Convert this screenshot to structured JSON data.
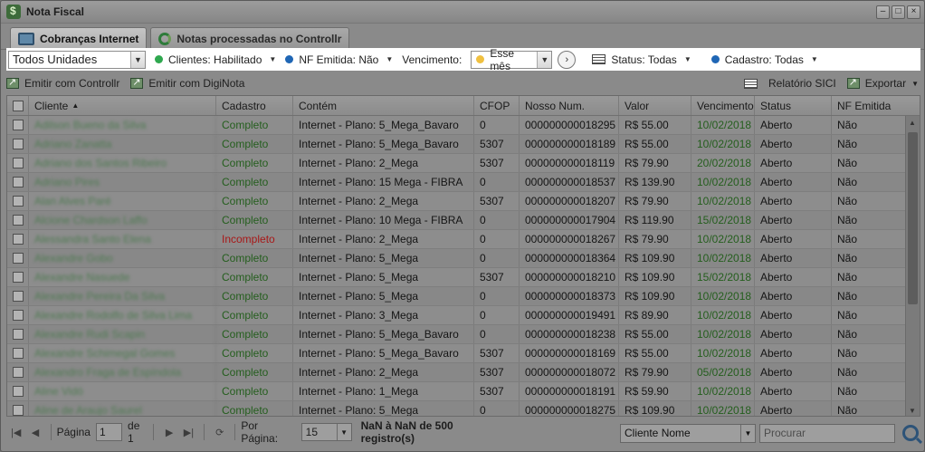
{
  "window": {
    "title": "Nota Fiscal"
  },
  "tabs": [
    {
      "label": "Cobranças Internet"
    },
    {
      "label": "Notas processadas no Controllr"
    }
  ],
  "filters": {
    "unit": "Todos Unidades",
    "clientes": "Clientes: Habilitado",
    "nf_emitida": "NF Emitida: Não",
    "vencimento_label": "Vencimento:",
    "vencimento_value": "Esse mês",
    "status": "Status: Todas",
    "cadastro": "Cadastro: Todas",
    "colors": {
      "clientes": "#2fa84f",
      "nf": "#1f66b5",
      "vencimento": "#f0c040",
      "cadastro": "#1f66b5"
    }
  },
  "toolbar": {
    "emit_controllr": "Emitir com Controllr",
    "emit_diginota": "Emitir com DigiNota",
    "relatorio": "Relatório SICI",
    "exportar": "Exportar"
  },
  "grid": {
    "columns": [
      "Cliente",
      "Cadastro",
      "Contém",
      "CFOP",
      "Nosso Num.",
      "Valor",
      "Vencimento",
      "Status",
      "NF Emitida"
    ],
    "rows": [
      {
        "cliente": "Adilson Bueno da Silva",
        "cadastro": "Completo",
        "contem": "Internet - Plano: 5_Mega_Bavaro",
        "cfop": "0",
        "nosso": "000000000018295",
        "valor": "R$ 55.00",
        "venc": "10/02/2018",
        "status": "Aberto",
        "nf": "Não"
      },
      {
        "cliente": "Adriano Zanatta",
        "cadastro": "Completo",
        "contem": "Internet - Plano: 5_Mega_Bavaro",
        "cfop": "5307",
        "nosso": "000000000018189",
        "valor": "R$ 55.00",
        "venc": "10/02/2018",
        "status": "Aberto",
        "nf": "Não"
      },
      {
        "cliente": "Adriano dos Santos Ribeiro",
        "cadastro": "Completo",
        "contem": "Internet - Plano: 2_Mega",
        "cfop": "5307",
        "nosso": "000000000018119",
        "valor": "R$ 79.90",
        "venc": "20/02/2018",
        "status": "Aberto",
        "nf": "Não"
      },
      {
        "cliente": "Adriano Pires",
        "cadastro": "Completo",
        "contem": "Internet - Plano: 15 Mega - FIBRA",
        "cfop": "0",
        "nosso": "000000000018537",
        "valor": "R$ 139.90",
        "venc": "10/02/2018",
        "status": "Aberto",
        "nf": "Não"
      },
      {
        "cliente": "Alan Alves Paré",
        "cadastro": "Completo",
        "contem": "Internet - Plano: 2_Mega",
        "cfop": "5307",
        "nosso": "000000000018207",
        "valor": "R$ 79.90",
        "venc": "10/02/2018",
        "status": "Aberto",
        "nf": "Não"
      },
      {
        "cliente": "Alcione Chardson Laffo",
        "cadastro": "Completo",
        "contem": "Internet - Plano: 10 Mega - FIBRA",
        "cfop": "0",
        "nosso": "000000000017904",
        "valor": "R$ 119.90",
        "venc": "15/02/2018",
        "status": "Aberto",
        "nf": "Não"
      },
      {
        "cliente": "Alessandra Santo Elena",
        "cadastro": "Incompleto",
        "contem": "Internet - Plano: 2_Mega",
        "cfop": "0",
        "nosso": "000000000018267",
        "valor": "R$ 79.90",
        "venc": "10/02/2018",
        "status": "Aberto",
        "nf": "Não"
      },
      {
        "cliente": "Alexandre Gobo",
        "cadastro": "Completo",
        "contem": "Internet - Plano: 5_Mega",
        "cfop": "0",
        "nosso": "000000000018364",
        "valor": "R$ 109.90",
        "venc": "10/02/2018",
        "status": "Aberto",
        "nf": "Não"
      },
      {
        "cliente": "Alexandre Nasuede",
        "cadastro": "Completo",
        "contem": "Internet - Plano: 5_Mega",
        "cfop": "5307",
        "nosso": "000000000018210",
        "valor": "R$ 109.90",
        "venc": "15/02/2018",
        "status": "Aberto",
        "nf": "Não"
      },
      {
        "cliente": "Alexandre Pereira Da Silva",
        "cadastro": "Completo",
        "contem": "Internet - Plano: 5_Mega",
        "cfop": "0",
        "nosso": "000000000018373",
        "valor": "R$ 109.90",
        "venc": "10/02/2018",
        "status": "Aberto",
        "nf": "Não"
      },
      {
        "cliente": "Alexandre Rodolfo de Silva Lima",
        "cadastro": "Completo",
        "contem": "Internet - Plano: 3_Mega",
        "cfop": "0",
        "nosso": "000000000019491",
        "valor": "R$ 89.90",
        "venc": "10/02/2018",
        "status": "Aberto",
        "nf": "Não"
      },
      {
        "cliente": "Alexandre Rudi Scapin",
        "cadastro": "Completo",
        "contem": "Internet - Plano: 5_Mega_Bavaro",
        "cfop": "0",
        "nosso": "000000000018238",
        "valor": "R$ 55.00",
        "venc": "10/02/2018",
        "status": "Aberto",
        "nf": "Não"
      },
      {
        "cliente": "Alexandre Schimegal Gomes",
        "cadastro": "Completo",
        "contem": "Internet - Plano: 5_Mega_Bavaro",
        "cfop": "5307",
        "nosso": "000000000018169",
        "valor": "R$ 55.00",
        "venc": "10/02/2018",
        "status": "Aberto",
        "nf": "Não"
      },
      {
        "cliente": "Alexandro Fraga de Espíndola",
        "cadastro": "Completo",
        "contem": "Internet - Plano: 2_Mega",
        "cfop": "5307",
        "nosso": "000000000018072",
        "valor": "R$ 79.90",
        "venc": "05/02/2018",
        "status": "Aberto",
        "nf": "Não"
      },
      {
        "cliente": "Aline Vidó",
        "cadastro": "Completo",
        "contem": "Internet - Plano: 1_Mega",
        "cfop": "5307",
        "nosso": "000000000018191",
        "valor": "R$ 59.90",
        "venc": "10/02/2018",
        "status": "Aberto",
        "nf": "Não"
      },
      {
        "cliente": "Aline de Araujo Saurel",
        "cadastro": "Completo",
        "contem": "Internet - Plano: 5_Mega",
        "cfop": "0",
        "nosso": "000000000018275",
        "valor": "R$ 109.90",
        "venc": "10/02/2018",
        "status": "Aberto",
        "nf": "Não"
      }
    ]
  },
  "pager": {
    "pagina_label": "Página",
    "page": "1",
    "de": "de 1",
    "por_pagina_label": "Por Página:",
    "per_page": "15",
    "summary": "NaN à NaN de 500 registro(s)"
  },
  "search": {
    "field": "Cliente Nome",
    "placeholder": "Procurar"
  }
}
